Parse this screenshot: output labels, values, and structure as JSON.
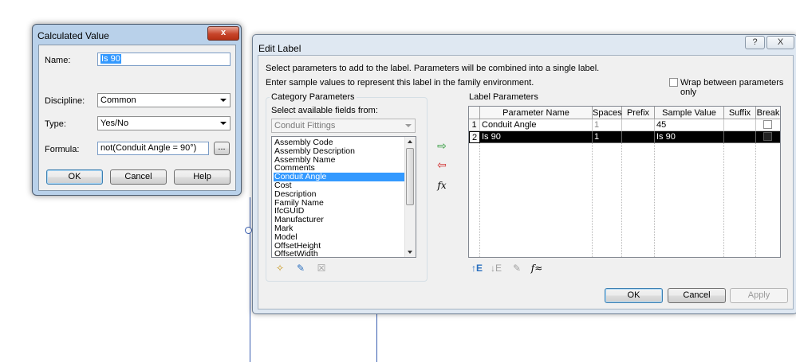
{
  "calc_dialog": {
    "title": "Calculated Value",
    "close_glyph": "x",
    "name_label": "Name:",
    "name_value": "Is 90",
    "discipline_label": "Discipline:",
    "discipline_value": "Common",
    "type_label": "Type:",
    "type_value": "Yes/No",
    "formula_label": "Formula:",
    "formula_value": "not(Conduit Angle = 90°)",
    "browse_label": "...",
    "ok_label": "OK",
    "cancel_label": "Cancel",
    "help_label": "Help"
  },
  "edit_dialog": {
    "title": "Edit Label",
    "help_glyph": "?",
    "close_glyph": "X",
    "instruction_1": "Select parameters to add to the label.  Parameters will be combined into a single label.",
    "instruction_2": "Enter sample values to represent this label in the family environment.",
    "wrap_label": "Wrap between parameters only",
    "category": {
      "group_label": "Category Parameters",
      "select_label": "Select available fields from:",
      "combo_value": "Conduit Fittings",
      "fields": [
        "Assembly Code",
        "Assembly Description",
        "Assembly Name",
        "Comments",
        "Conduit Angle",
        "Cost",
        "Description",
        "Family Name",
        "IfcGUID",
        "Manufacturer",
        "Mark",
        "Model",
        "OffsetHeight",
        "OffsetWidth"
      ],
      "selected_field": "Conduit Angle"
    },
    "fx_glyph": "fx",
    "label_params": {
      "group_label": "Label Parameters",
      "columns": [
        "",
        "Parameter Name",
        "Spaces",
        "Prefix",
        "Sample Value",
        "Suffix",
        "Break"
      ],
      "rows": [
        {
          "num": "1",
          "name": "Conduit Angle",
          "spaces": "1",
          "prefix": "",
          "sample": "45",
          "suffix": ""
        },
        {
          "num": "2",
          "name": "Is 90",
          "spaces": "1",
          "prefix": "",
          "sample": "Is 90",
          "suffix": ""
        }
      ],
      "selected_row": "2"
    },
    "ok_label": "OK",
    "cancel_label": "Cancel",
    "apply_label": "Apply"
  }
}
